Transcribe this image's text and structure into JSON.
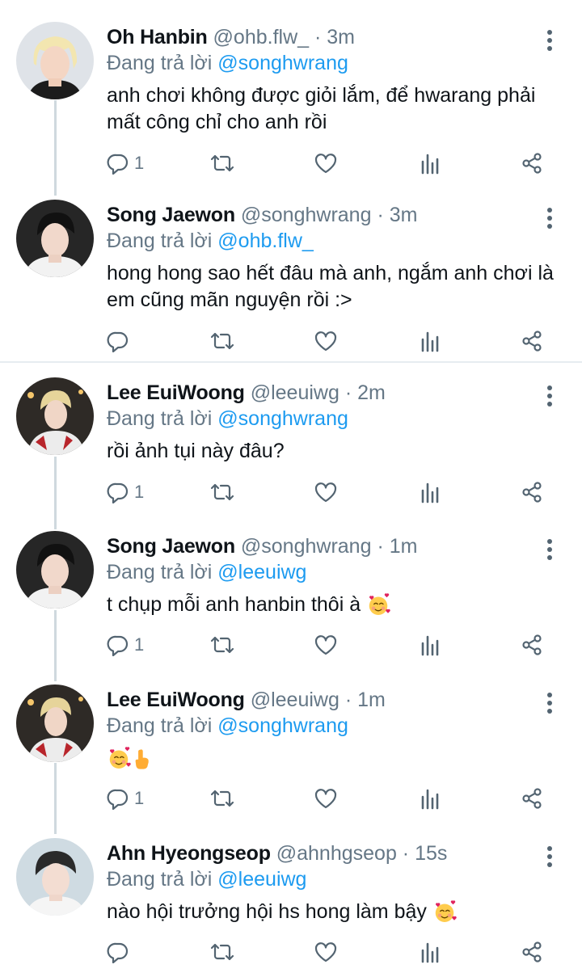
{
  "colors": {
    "link": "#1d9bf0",
    "muted": "#657786",
    "text": "#0f1419",
    "thread_line": "#cfd9de"
  },
  "replying_prefix": "Đang trả lời",
  "tweets": [
    {
      "name": "Oh Hanbin",
      "handle": "@ohb.flw_",
      "time": "· 3m",
      "reply_to": "@songhwrang",
      "text": "anh chơi không được giỏi lắm, để hwarang phải mất công chỉ cho anh rồi",
      "reply_count": "1"
    },
    {
      "name": "Song Jaewon",
      "handle": "@songhwrang",
      "time": "· 3m",
      "reply_to": "@ohb.flw_",
      "text": "hong hong sao hết đâu mà anh, ngắm anh chơi là em cũng mãn nguyện rồi :>",
      "reply_count": ""
    },
    {
      "name": "Lee EuiWoong",
      "handle": "@leeuiwg",
      "time": "· 2m",
      "reply_to": "@songhwrang",
      "text": "rồi ảnh tụi này đâu?",
      "reply_count": "1"
    },
    {
      "name": "Song Jaewon",
      "handle": "@songhwrang",
      "time": "· 1m",
      "reply_to": "@leeuiwg",
      "text": "t chụp mỗi anh hanbin thôi à",
      "emoji": "smiling-face-with-hearts",
      "reply_count": "1"
    },
    {
      "name": "Lee EuiWoong",
      "handle": "@leeuiwg",
      "time": "· 1m",
      "reply_to": "@songhwrang",
      "text": "",
      "emoji": "smiling-face-with-hearts, pointing-up-hand",
      "reply_count": "1"
    },
    {
      "name": "Ahn Hyeongseop",
      "handle": "@ahnhgseop",
      "time": "· 15s",
      "reply_to": "@leeuiwg",
      "text": "nào hội trưởng hội hs hong làm bậy",
      "emoji": "smiling-face-with-hearts",
      "reply_count": ""
    }
  ]
}
